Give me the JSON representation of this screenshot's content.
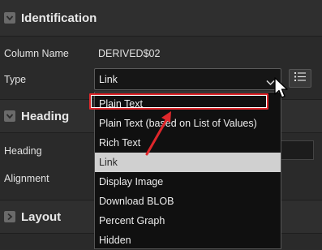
{
  "sections": {
    "identification": {
      "title": "Identification"
    },
    "heading": {
      "title": "Heading"
    },
    "layout": {
      "title": "Layout"
    }
  },
  "identification": {
    "column_name_label": "Column Name",
    "column_name_value": "DERIVED$02",
    "type_label": "Type",
    "type_value": "Link"
  },
  "heading": {
    "heading_label": "Heading",
    "alignment_label": "Alignment"
  },
  "dropdown": {
    "options": [
      "Plain Text",
      "Plain Text (based on List of Values)",
      "Rich Text",
      "Link",
      "Display Image",
      "Download BLOB",
      "Percent Graph",
      "Hidden"
    ],
    "selected": "Link"
  },
  "colors": {
    "annotation_red": "#e0272b",
    "selected_option_bg": "#d0d0d0"
  },
  "icons": {
    "section_toggle": "chevron-down-icon",
    "layout_toggle": "chevron-right-icon",
    "list_button": "list-icon",
    "select_chevron": "chevron-down-icon",
    "cursor": "mouse-pointer-icon"
  }
}
